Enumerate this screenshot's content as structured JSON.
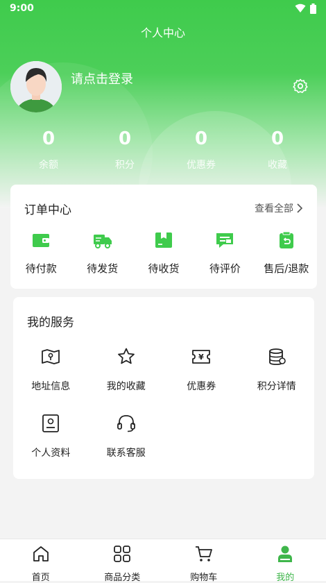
{
  "status_bar": {
    "time": "9:00"
  },
  "page": {
    "title": "个人中心"
  },
  "profile": {
    "login_prompt": "请点击登录"
  },
  "stats": [
    {
      "value": "0",
      "label": "余额"
    },
    {
      "value": "0",
      "label": "积分"
    },
    {
      "value": "0",
      "label": "优惠券"
    },
    {
      "value": "0",
      "label": "收藏"
    }
  ],
  "orders": {
    "title": "订单中心",
    "view_all": "查看全部",
    "items": [
      {
        "label": "待付款",
        "icon": "wallet-icon"
      },
      {
        "label": "待发货",
        "icon": "truck-icon"
      },
      {
        "label": "待收货",
        "icon": "box-icon"
      },
      {
        "label": "待评价",
        "icon": "comment-icon"
      },
      {
        "label": "售后/退款",
        "icon": "refund-icon"
      }
    ]
  },
  "services": {
    "title": "我的服务",
    "items": [
      {
        "label": "地址信息",
        "icon": "map-icon"
      },
      {
        "label": "我的收藏",
        "icon": "star-icon"
      },
      {
        "label": "优惠券",
        "icon": "coupon-icon"
      },
      {
        "label": "积分详情",
        "icon": "coins-icon"
      },
      {
        "label": "个人资料",
        "icon": "profile-card-icon"
      },
      {
        "label": "联系客服",
        "icon": "headset-icon"
      }
    ]
  },
  "tabbar": [
    {
      "label": "首页",
      "icon": "home-icon",
      "active": false
    },
    {
      "label": "商品分类",
      "icon": "grid-icon",
      "active": false
    },
    {
      "label": "购物车",
      "icon": "cart-icon",
      "active": false
    },
    {
      "label": "我的",
      "icon": "user-icon",
      "active": true
    }
  ],
  "colors": {
    "primary": "#3fcb4c",
    "active_tab": "#3fb64b"
  }
}
